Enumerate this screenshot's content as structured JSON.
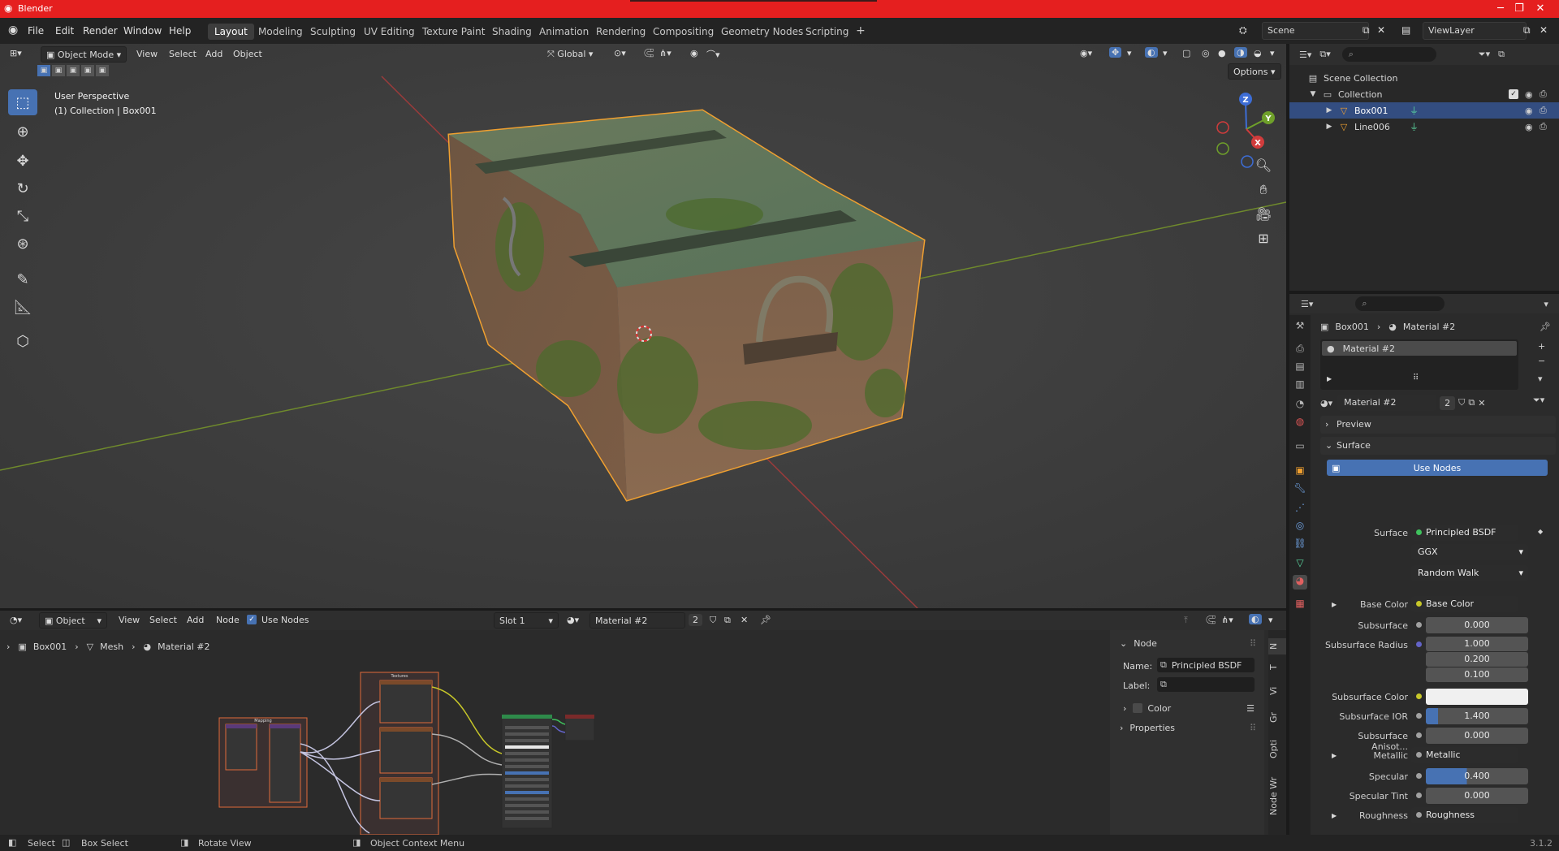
{
  "window": {
    "title": "Blender",
    "title_bar_color": "#e51f1f"
  },
  "menubar": {
    "menus": [
      "File",
      "Edit",
      "Render",
      "Window",
      "Help"
    ],
    "workspaces": [
      "Layout",
      "Modeling",
      "Sculpting",
      "UV Editing",
      "Texture Paint",
      "Shading",
      "Animation",
      "Rendering",
      "Compositing",
      "Geometry Nodes",
      "Scripting"
    ],
    "active_workspace": "Layout",
    "add_tab": "+",
    "scene": "Scene",
    "view_layer": "ViewLayer"
  },
  "viewport": {
    "mode": "Object Mode",
    "menus": [
      "View",
      "Select",
      "Add",
      "Object"
    ],
    "transform_orientation": "Global",
    "options": "Options",
    "overlay_title": "User Perspective",
    "overlay_subtitle": "(1) Collection | Box001",
    "gizmo_axes": [
      "X",
      "Y",
      "Z"
    ],
    "grid_x_color": "#9a3b3b",
    "grid_y_color": "#6f8a2c",
    "selection_outline_color": "#f0a030"
  },
  "outliner": {
    "root": "Scene Collection",
    "collection": "Collection",
    "objects": [
      {
        "name": "Box001",
        "selected": true
      },
      {
        "name": "Line006",
        "selected": false
      }
    ]
  },
  "properties": {
    "breadcrumb_object": "Box001",
    "breadcrumb_material": "Material #2",
    "material_slot": "Material #2",
    "material_name": "Material #2",
    "material_users": "2",
    "preview_label": "Preview",
    "surface_label": "Surface",
    "use_nodes_button": "Use Nodes",
    "rows": {
      "surface": {
        "label": "Surface",
        "value": "Principled BSDF"
      },
      "distribution": "GGX",
      "subsurface_method": "Random Walk",
      "base_color": {
        "label": "Base Color",
        "value": "Base Color"
      },
      "subsurface": {
        "label": "Subsurface",
        "value": "0.000"
      },
      "subsurface_radius": {
        "label": "Subsurface Radius",
        "values": [
          "1.000",
          "0.200",
          "0.100"
        ]
      },
      "subsurface_color": {
        "label": "Subsurface Color"
      },
      "subsurface_ior": {
        "label": "Subsurface IOR",
        "value": "1.400"
      },
      "subsurface_aniso": {
        "label": "Subsurface Anisot...",
        "value": "0.000"
      },
      "metallic": {
        "label": "Metallic",
        "value": "Metallic"
      },
      "specular": {
        "label": "Specular",
        "value": "0.400"
      },
      "specular_tint": {
        "label": "Specular Tint",
        "value": "0.000"
      },
      "roughness": {
        "label": "Roughness",
        "value": "Roughness"
      }
    }
  },
  "node_editor": {
    "type": "Object",
    "menus": [
      "View",
      "Select",
      "Add",
      "Node"
    ],
    "use_nodes": "Use Nodes",
    "slot": "Slot 1",
    "material": "Material #2",
    "users": "2",
    "breadcrumb": [
      "Box001",
      "Mesh",
      "Material #2"
    ],
    "frame_labels": [
      "Mapping",
      "Textures"
    ],
    "sidebar": {
      "section": "Node",
      "name_label": "Name:",
      "name_value": "Principled BSDF",
      "label_label": "Label:",
      "color_label": "Color",
      "properties_label": "Properties"
    },
    "tabs": [
      "Node Wr",
      "Opti",
      "Gr",
      "Vi",
      "T",
      "N"
    ]
  },
  "statusbar": {
    "items": [
      "Select",
      "Box Select",
      "Rotate View",
      "Object Context Menu"
    ],
    "version": "3.1.2"
  }
}
